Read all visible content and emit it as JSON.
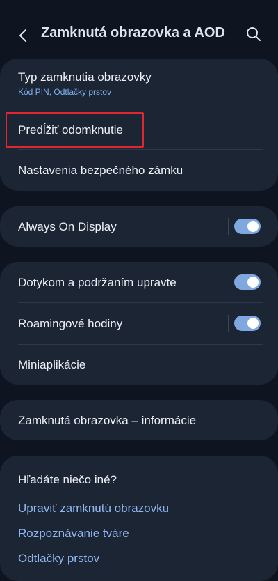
{
  "header": {
    "title": "Zamknutá obrazovka a AOD",
    "back_icon": "chevron-left-icon",
    "search_icon": "search-icon"
  },
  "group1": {
    "lock_type": {
      "title": "Typ zamknutia obrazovky",
      "subtitle": "Kód PIN, Odtlačky prstov"
    },
    "extend_unlock": {
      "title": "Predĺžiť odomknutie"
    },
    "secure_lock": {
      "title": "Nastavenia bezpečného zámku"
    }
  },
  "group2": {
    "aod": {
      "title": "Always On Display",
      "enabled": true
    }
  },
  "group3": {
    "touch_hold": {
      "title": "Dotykom a podržaním upravte",
      "enabled": true
    },
    "roaming_clock": {
      "title": "Roamingové hodiny",
      "enabled": true
    },
    "widgets": {
      "title": "Miniaplikácie"
    }
  },
  "group4": {
    "about": {
      "title": "Zamknutá obrazovka – informácie"
    }
  },
  "suggestions": {
    "heading": "Hľadáte niečo iné?",
    "links": [
      "Upraviť zamknutú obrazovku",
      "Rozpoznávanie tváre",
      "Odtlačky prstov"
    ]
  },
  "colors": {
    "background": "#0f1520",
    "card": "#1c2534",
    "accent": "#7fa8e0",
    "highlight": "#e0262f"
  }
}
